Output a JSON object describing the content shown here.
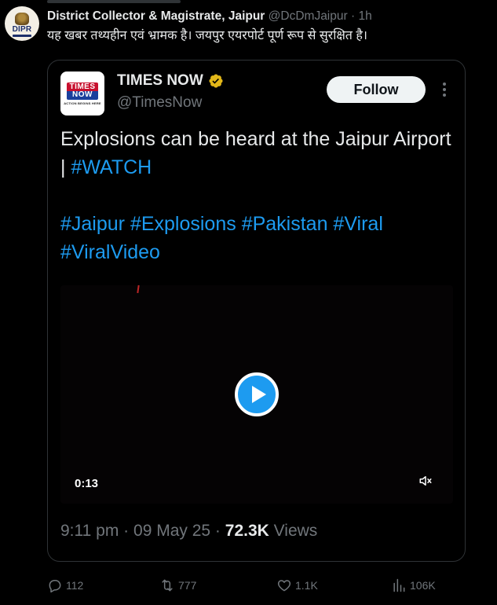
{
  "tweet": {
    "author_name": "District Collector & Magistrate, Jaipur",
    "handle": "@DcDmJaipur",
    "separator": "·",
    "time": "1h",
    "avatar_text": "DIPR",
    "text": "यह खबर तथ्यहीन एवं भ्रामक है। जयपुर एयरपोर्ट पूर्ण रूप से सुरक्षित है।"
  },
  "quote": {
    "author_name": "TIMES NOW",
    "handle": "@TimesNow",
    "follow_label": "Follow",
    "logo_line1": "TIMES",
    "logo_line2": "NOW",
    "logo_tagline": "ACTION BEGINS HERE",
    "text_main": "Explosions can be heard at the Jaipur Airport | ",
    "text_hashtag": "#WATCH",
    "hashtags": "#Jaipur #Explosions #Pakistan #Viral #ViralVideo",
    "video_duration": "0:13",
    "time": "9:11 pm",
    "separator1": "·",
    "date": "09 May 25",
    "separator2": "·",
    "views_count": "72.3K",
    "views_label": "Views"
  },
  "actions": {
    "replies": "112",
    "retweets": "777",
    "likes": "1.1K",
    "views": "106K"
  },
  "colors": {
    "background": "#000000",
    "text": "#e7e9ea",
    "muted": "#71767b",
    "accent": "#1d9bf0",
    "border": "#2f3336",
    "verified_gold": "#e2b719"
  },
  "icons": [
    "verified-icon",
    "more-icon",
    "play-icon",
    "volume-icon",
    "reply-icon",
    "retweet-icon",
    "like-icon",
    "views-icon"
  ]
}
